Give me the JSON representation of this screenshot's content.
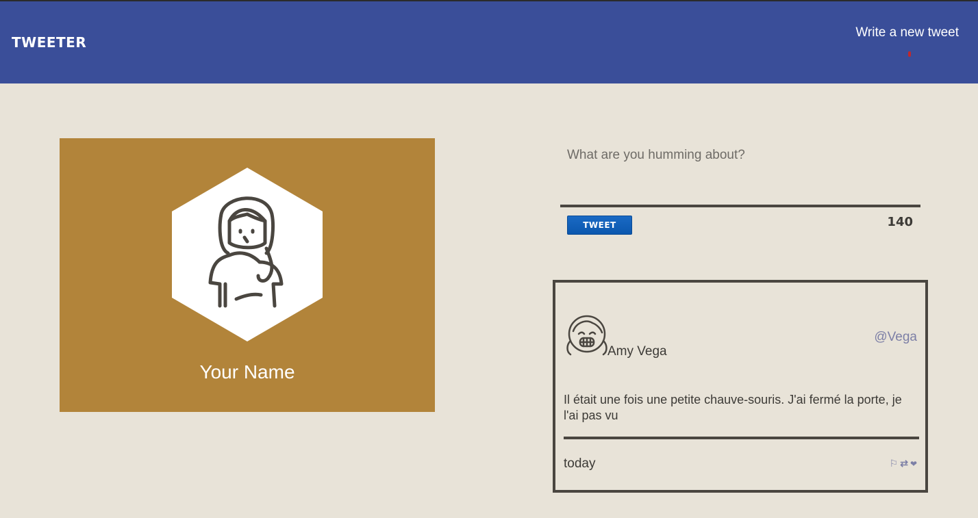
{
  "nav": {
    "brand": "TWEETER",
    "compose_link": "Write a new tweet"
  },
  "profile": {
    "name": "Your Name"
  },
  "composer": {
    "placeholder": "What are you humming about?",
    "button_label": "TWEET",
    "char_count": "140"
  },
  "tweets": [
    {
      "display_name": "Amy Vega",
      "handle": "@Vega",
      "body": "Il était une fois une petite chauve-souris. J'ai fermé la porte, je l'ai pas vu",
      "timestamp": "today",
      "actions": [
        {
          "icon": "flag-icon",
          "glyph": "⚐"
        },
        {
          "icon": "retweet-icon",
          "glyph": "⇄"
        },
        {
          "icon": "heart-icon",
          "glyph": "❤"
        }
      ]
    }
  ],
  "colors": {
    "navbar": "#3a4e99",
    "background": "#e8e3d8",
    "profile_card": "#b2843a",
    "tweet_button": "#1565c0",
    "handle": "#7c7fa6"
  }
}
